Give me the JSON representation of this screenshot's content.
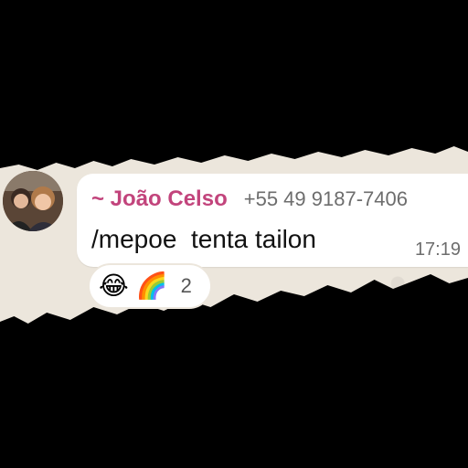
{
  "message": {
    "sender_name": "~ João Celso",
    "sender_phone": "+55 49 9187-7406",
    "text": "/mepoe  tenta tailon",
    "time": "17:19"
  },
  "reactions": {
    "emojis": [
      {
        "icon": "laughing-tears-emoji",
        "glyph": "😂"
      },
      {
        "icon": "rainbow-cloud-emoji",
        "glyph": "🌈"
      }
    ],
    "count": "2"
  },
  "colors": {
    "sender_name": "#c2447c",
    "chat_background": "#ece6dc",
    "bubble": "#ffffff"
  }
}
